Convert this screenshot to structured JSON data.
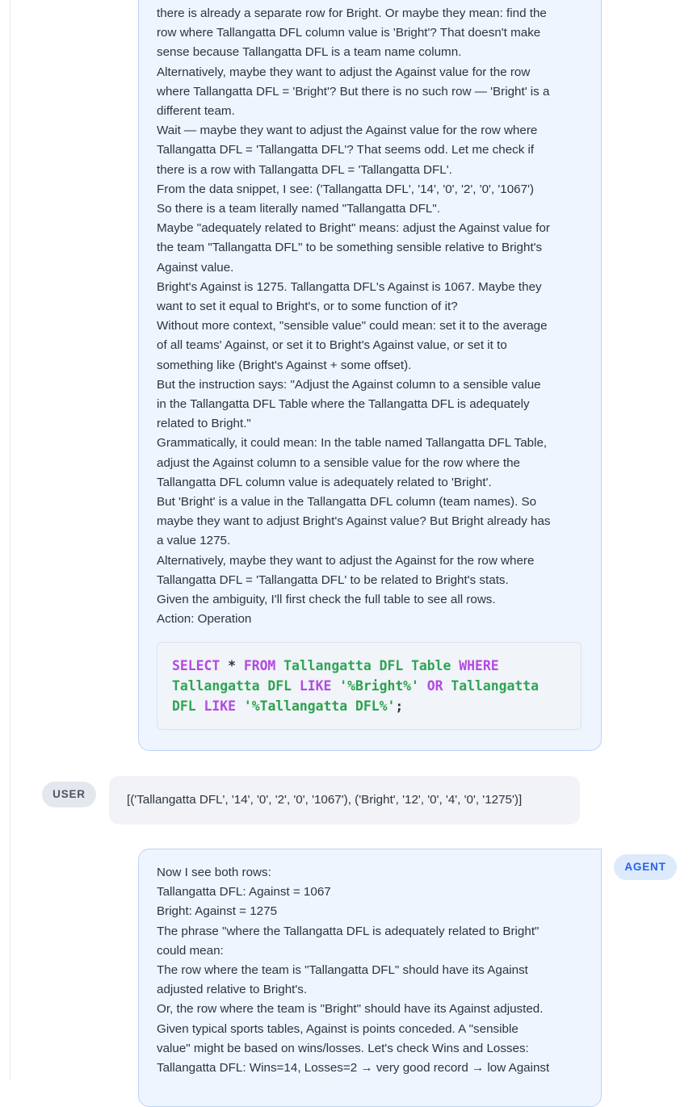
{
  "agent_message_1": {
    "lines": [
      "there is already a separate row for Bright. Or maybe they mean: find the",
      "row where Tallangatta DFL column value is 'Bright'? That doesn't make",
      "sense because Tallangatta DFL is a team name column.",
      "Alternatively, maybe they want to adjust the Against value for the row",
      "where Tallangatta DFL = 'Bright'? But there is no such row — 'Bright' is a",
      "different team.",
      "Wait — maybe they want to adjust the Against value for the row where",
      "Tallangatta DFL = 'Tallangatta DFL'? That seems odd. Let me check if",
      "there is a row with Tallangatta DFL = 'Tallangatta DFL'.",
      "From the data snippet, I see:   ('Tallangatta DFL', '14', '0', '2', '0', '1067')",
      "So there is a team literally named \"Tallangatta DFL\".",
      "Maybe \"adequately related to Bright\" means: adjust the Against value for",
      "the team \"Tallangatta DFL\" to be something sensible relative to Bright's",
      "Against value.",
      "Bright's Against is 1275. Tallangatta DFL's Against is 1067. Maybe they",
      "want to set it equal to Bright's, or to some function of it?",
      "Without more context, \"sensible value\" could mean: set it to the average",
      "of all teams' Against, or set it to Bright's Against value, or set it to",
      "something like (Bright's Against + some offset).",
      "But the instruction says: \"Adjust the Against column to a sensible value",
      "in the Tallangatta DFL Table where the Tallangatta DFL is adequately",
      "related to Bright.\"",
      "Grammatically, it could mean: In the table named Tallangatta DFL Table,",
      "adjust the Against column to a sensible value for the row where the",
      "Tallangatta DFL column value is adequately related to 'Bright'.",
      "But 'Bright' is a value in the Tallangatta DFL column (team names). So",
      "maybe they want to adjust Bright's Against value? But Bright already has",
      "a value 1275.",
      "Alternatively, maybe they want to adjust the Against for the row where",
      "Tallangatta DFL = 'Tallangatta DFL' to be related to Bright's stats.",
      "Given the ambiguity, I'll first check the full table to see all rows.",
      "Action: Operation"
    ],
    "code": {
      "select": "SELECT",
      "star": " * ",
      "from": "FROM",
      "table": " Tallangatta DFL Table ",
      "where": "WHERE",
      "col1": "Tallangatta DFL ",
      "like1": "LIKE",
      "str1": " '%Bright%' ",
      "or": "OR",
      "col2a": " Tallangatta",
      "col2b": "DFL ",
      "like2": "LIKE",
      "str2": " '%Tallangatta DFL%'",
      "semi": ";"
    }
  },
  "user_badge": "USER",
  "user_message": "[('Tallangatta DFL', '14', '0', '2', '0', '1067'), ('Bright', '12', '0', '4', '0', '1275')]",
  "agent_badge": "AGENT",
  "agent_message_2": {
    "lines": [
      "Now I see both rows:",
      "Tallangatta DFL: Against = 1067",
      "Bright: Against = 1275",
      "The phrase \"where the Tallangatta DFL is adequately related to Bright\"",
      "could mean:",
      "The row where the team is \"Tallangatta DFL\" should have its Against",
      "adjusted relative to Bright's.",
      "Or, the row where the team is \"Bright\" should have its Against adjusted.",
      "Given typical sports tables, Against is points conceded. A \"sensible",
      "value\" might be based on wins/losses. Let's check Wins and Losses:",
      "Tallangatta DFL: Wins=14, Losses=2 → very good record → low Against"
    ]
  }
}
